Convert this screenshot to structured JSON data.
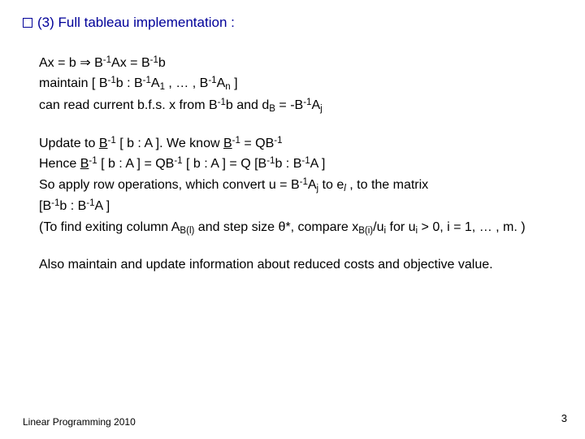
{
  "heading": "(3) Full tableau implementation :",
  "block1": {
    "l1a": "Ax = b   ",
    "arrow": "⇒",
    "l1b_pre": "    B",
    "l1b_mid": "Ax = B",
    "l1b_end": "b",
    "l2_pre": "maintain  [ B",
    "l2_a": "b : B",
    "l2_b": " , … , B",
    "l2_c": " ]",
    "l3_pre": "can read current b.f.s.  x  from  B",
    "l3_mid": "b  and  d",
    "l3_eq": " = -B",
    "A1": "A",
    "An": "A",
    "Aj": "A",
    "sub1": "1",
    "subn": "n",
    "subB": "B",
    "subj": "j"
  },
  "block2": {
    "l1_pre": "Update to  ",
    "l1_B": "B",
    "l1_mid": " [ b : A ].    We know  ",
    "l1_B2": "B",
    "l1_eq": " = QB",
    "l2_pre": "Hence ",
    "l2_B": "B",
    "l2_a": " [ b : A ] = QB",
    "l2_b": " [ b : A ] = Q [B",
    "l2_c": "b : B",
    "l2_d": "A ]",
    "l3_a": "So apply row operations, which convert  u = B",
    "l3_b": "  to  e",
    "l3_c": " , to the matrix",
    "l4_a": "[B",
    "l4_b": "b : B",
    "l4_c": "A ]",
    "l5_a": "(To find exiting column A",
    "l5_b": " and step size θ*, compare x",
    "l5_c": "/u",
    "l5_d": " for u",
    "l5_e": " > 0,  i = 1, … , m. )",
    "subBl": "B(l)",
    "subBi": "B(i)",
    "subi": "i",
    "subl": "l",
    "Aj": "A",
    "subj": "j"
  },
  "block3": "Also maintain and update information about reduced costs and objective value.",
  "footer": "Linear Programming 2010",
  "page": "3",
  "neg1": "-1"
}
